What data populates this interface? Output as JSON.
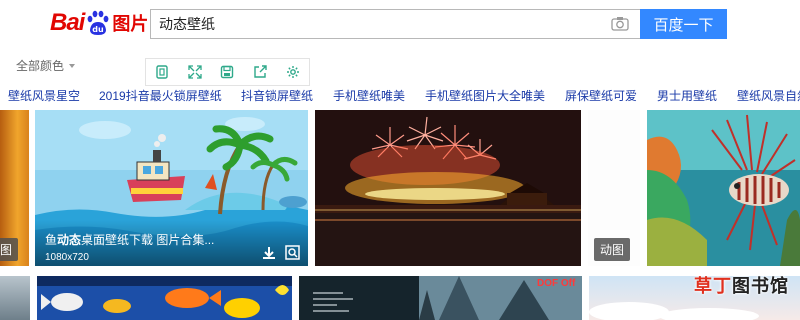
{
  "search": {
    "query": "动态壁纸",
    "button": "百度一下"
  },
  "filter": {
    "color_label": "全部颜色"
  },
  "tags": [
    "壁纸风景星空",
    "2019抖音最火锁屏壁纸",
    "抖音锁屏壁纸",
    "手机壁纸唯美",
    "手机壁纸图片大全唯美",
    "屏保壁纸可爱",
    "男士用壁纸",
    "壁纸风景自然"
  ],
  "tiles": {
    "first_caption_title_pre": "鱼",
    "first_caption_title_em": "动态",
    "first_caption_title_post": "桌面壁纸下载 图片合集...",
    "first_caption_size": "1080x720",
    "left_badge": "图",
    "fireworks_badge": "动图",
    "dof_label": "DOF Off"
  },
  "watermark": {
    "hl": "草丁",
    "rest": "图书馆"
  },
  "colors": {
    "brand_red": "#e10602",
    "brand_blue": "#2932e1",
    "button_blue": "#3388ff",
    "tag_blue": "#1a3aa8",
    "tool_green": "#2ea98a"
  }
}
